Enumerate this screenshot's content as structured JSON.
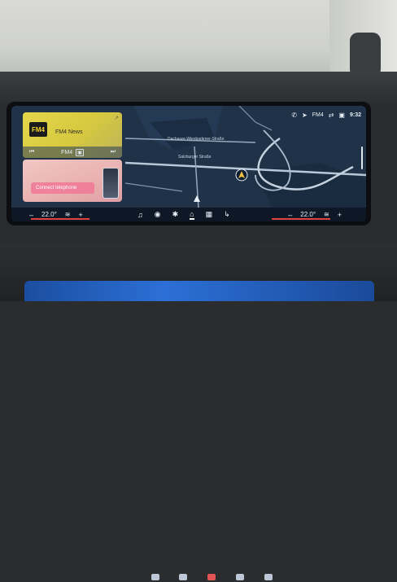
{
  "status": {
    "icons": [
      "phone-icon",
      "navigation-arrow-icon",
      "radio-icon",
      "link-icon",
      "media-icon"
    ],
    "station": "FM4",
    "time": "9:32"
  },
  "media": {
    "subtitle": "",
    "title": "FM4 News",
    "logo": "FM4",
    "station": "FM4",
    "prev": "⏮",
    "next": "⏭",
    "station_icon": "▣",
    "corner": "↗"
  },
  "phone": {
    "button_label": "Connect telephone"
  },
  "map": {
    "roads": [
      "Dachauer-Wiesbadener-Straße",
      "Salzburger Straße"
    ]
  },
  "climate": {
    "left_temp": "22.0°",
    "right_temp": "22.0°",
    "minus": "–",
    "plus": "+",
    "seat_heat_icon": "seat-heating-icon",
    "colors": {
      "heat": "#e04242",
      "bar": "#0d1726"
    }
  },
  "dock": {
    "icons": [
      "♫",
      "◉",
      "✱",
      "⌂",
      "▦",
      "↳"
    ]
  }
}
